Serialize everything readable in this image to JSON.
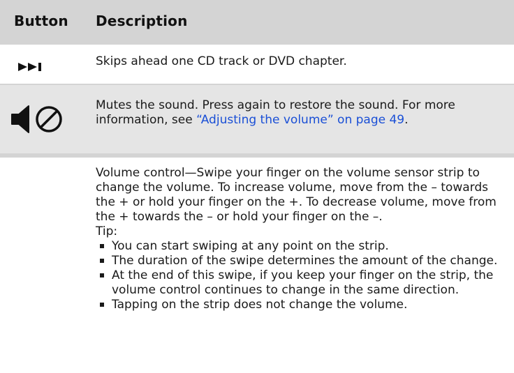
{
  "header": {
    "button_label": "Button",
    "description_label": "Description"
  },
  "rows": [
    {
      "icon": "next-track-icon",
      "description": "Skips ahead one CD track or DVD chapter."
    },
    {
      "icon": "mute-icon",
      "description_prefix": "Mutes the sound. Press again to restore the sound. For more information, see ",
      "link_text": "“Adjusting the volume” on page 49",
      "description_suffix": "."
    },
    {
      "icon": "",
      "description": "Volume control—Swipe your finger on the volume sensor strip to change the volume. To increase volume, move from the – towards the + or hold your finger on the +. To decrease volume, move from the + towards the – or hold your finger on the –.",
      "tip_label": "Tip:",
      "tips": [
        "You can start swiping at any point on the strip.",
        "The duration of the swipe determines the amount of the change.",
        "At the end of this swipe, if you keep your finger on the strip, the volume control continues to change in the same direction.",
        "Tapping on the strip does not change the volume."
      ]
    }
  ],
  "colors": {
    "header_bg": "#d4d4d4",
    "alt_row_bg": "#e5e5e5",
    "link": "#1a4fd6"
  }
}
